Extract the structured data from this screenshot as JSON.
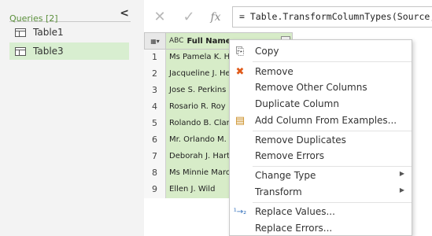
{
  "queries": {
    "header": "Queries [2]",
    "items": [
      {
        "label": "Table1",
        "selected": false
      },
      {
        "label": "Table3",
        "selected": true
      }
    ]
  },
  "formula_bar": {
    "cancel": "✕",
    "commit": "✓",
    "fx": "fx",
    "text": "= Table.TransformColumnTypes(Source,{{"
  },
  "grid": {
    "column_header": {
      "type_badge": "ABC",
      "label": "Full Name"
    },
    "rows": [
      {
        "n": "1",
        "name": "Ms Pamela K. Hi"
      },
      {
        "n": "2",
        "name": "Jacqueline J. He"
      },
      {
        "n": "3",
        "name": "Jose S. Perkins"
      },
      {
        "n": "4",
        "name": "Rosario R. Roy"
      },
      {
        "n": "5",
        "name": "Rolando B. Clarl"
      },
      {
        "n": "6",
        "name": "Mr. Orlando M."
      },
      {
        "n": "7",
        "name": "Deborah J. Hart"
      },
      {
        "n": "8",
        "name": "Ms Minnie Marc"
      },
      {
        "n": "9",
        "name": "Ellen J. Wild"
      }
    ]
  },
  "context_menu": {
    "items": [
      {
        "label": "Copy",
        "icon": "copy-icon"
      },
      {
        "label": "Remove",
        "icon": "remove-icon"
      },
      {
        "label": "Remove Other Columns"
      },
      {
        "label": "Duplicate Column"
      },
      {
        "label": "Add Column From Examples...",
        "icon": "examples-icon"
      },
      {
        "label": "Remove Duplicates"
      },
      {
        "label": "Remove Errors"
      },
      {
        "label": "Change Type",
        "submenu": true
      },
      {
        "label": "Transform",
        "submenu": true
      },
      {
        "label": "Replace Values...",
        "icon": "replace-values-icon"
      },
      {
        "label": "Replace Errors..."
      }
    ]
  },
  "colors": {
    "accent_green": "#d7ecc8",
    "selected_query": "#d8eed0",
    "header_label": "#5a8f3a"
  }
}
